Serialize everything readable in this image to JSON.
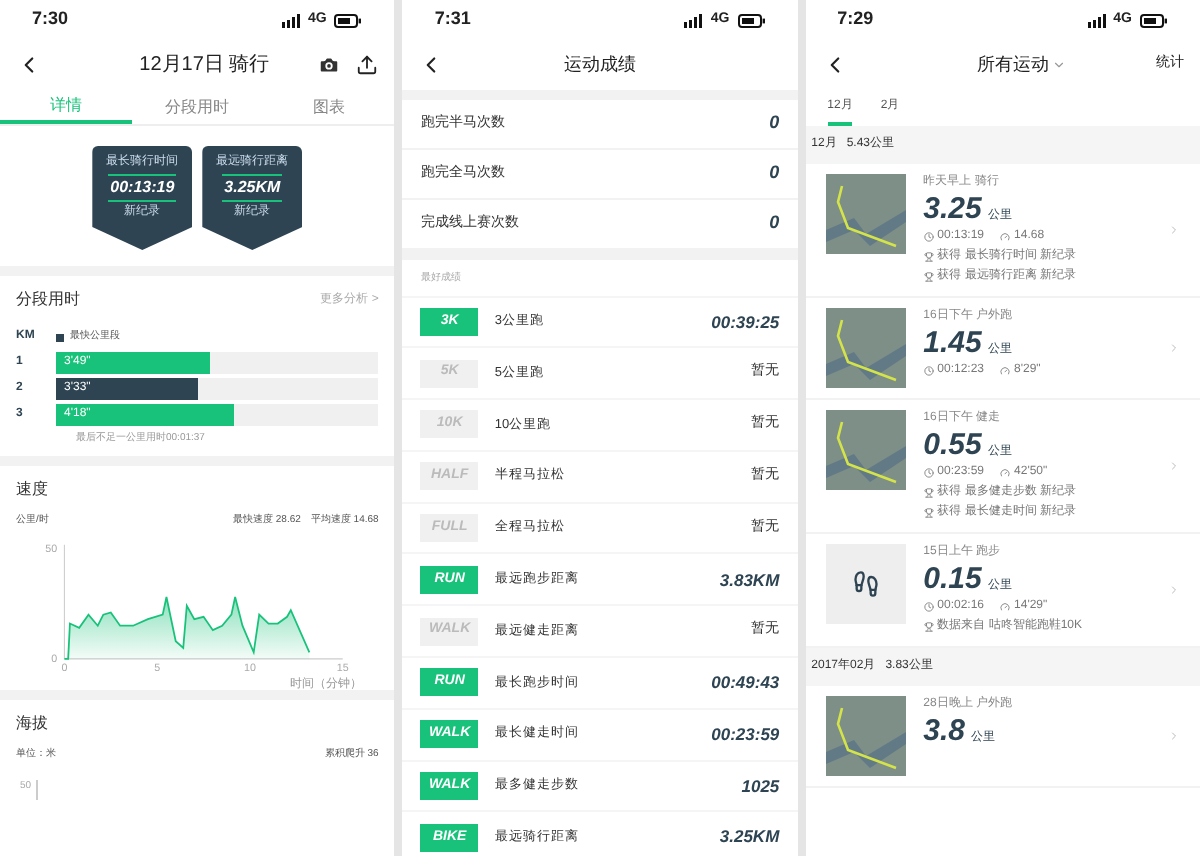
{
  "panels": [
    {
      "status_bar": {
        "time": "7:30",
        "network": "4G"
      },
      "header": {
        "title": "12月17日 骑行"
      },
      "tabs": [
        {
          "label": "详情",
          "selected": true
        },
        {
          "label": "分段用时",
          "selected": false
        },
        {
          "label": "图表",
          "selected": false
        }
      ],
      "badges": [
        {
          "title": "最长骑行时间",
          "value": "00:13:19",
          "sub": "新纪录"
        },
        {
          "title": "最远骑行距离",
          "value": "3.25KM",
          "sub": "新纪录"
        }
      ],
      "splits": {
        "title": "分段用时",
        "more": "更多分析 >",
        "km_label": "KM",
        "legend": "最快公里段",
        "rows": [
          {
            "km": "1",
            "time": "3'49\"",
            "level": 0.48,
            "fastest": false
          },
          {
            "km": "2",
            "time": "3'33\"",
            "level": 0.44,
            "fastest": true
          },
          {
            "km": "3",
            "time": "4'18\"",
            "level": 0.55,
            "fastest": false
          }
        ],
        "note": "最后不足一公里用时00:01:37"
      },
      "speed": {
        "title": "速度",
        "unit": "公里/时",
        "max": "最快速度 28.62",
        "avg": "平均速度 14.68",
        "chart_data": {
          "type": "area",
          "xlabel": "时间（分钟）",
          "x": [
            0,
            0.2,
            0.3,
            0.8,
            1.3,
            1.8,
            2.1,
            2.5,
            3,
            3.7,
            4.5,
            5.3,
            5.5,
            6,
            6.4,
            6.6,
            7,
            7.5,
            8,
            8.5,
            9,
            9.2,
            9.6,
            10.2,
            10.5,
            11,
            11.5,
            12,
            12.2,
            13.2
          ],
          "series": [
            {
              "color": "#19c27a",
              "values": [
                0,
                0,
                16,
                14,
                20,
                15,
                20,
                21,
                15,
                15,
                18,
                20,
                28,
                8,
                5,
                24,
                18,
                19,
                13,
                15,
                20,
                28,
                15,
                3,
                20,
                16,
                16,
                19,
                22,
                3
              ]
            }
          ],
          "xlim": [
            0,
            15
          ],
          "ylim": [
            0,
            50
          ],
          "xticks": [
            0,
            5,
            10,
            15
          ],
          "yticks": [
            0,
            50
          ]
        }
      },
      "altitude": {
        "title": "海拔",
        "unit": "单位：米",
        "climb": "累积爬升 36",
        "ytick": "50"
      }
    },
    {
      "status_bar": {
        "time": "7:31",
        "network": "4G"
      },
      "header": {
        "title": "运动成绩"
      },
      "counts": [
        {
          "label": "跑完半马次数",
          "value": "0"
        },
        {
          "label": "跑完全马次数",
          "value": "0"
        },
        {
          "label": "完成线上赛次数",
          "value": "0"
        }
      ],
      "records_title": "最好成绩",
      "records": [
        {
          "tag": "3K",
          "label": "3公里跑",
          "value": "00:39:25",
          "achieved": true
        },
        {
          "tag": "5K",
          "label": "5公里跑",
          "value": "暂无",
          "achieved": false
        },
        {
          "tag": "10K",
          "label": "10公里跑",
          "value": "暂无",
          "achieved": false
        },
        {
          "tag": "HALF",
          "label": "半程马拉松",
          "value": "暂无",
          "achieved": false
        },
        {
          "tag": "FULL",
          "label": "全程马拉松",
          "value": "暂无",
          "achieved": false
        },
        {
          "tag": "RUN",
          "label": "最远跑步距离",
          "value": "3.83KM",
          "achieved": true
        },
        {
          "tag": "WALK",
          "label": "最远健走距离",
          "value": "暂无",
          "achieved": false
        },
        {
          "tag": "RUN",
          "label": "最长跑步时间",
          "value": "00:49:43",
          "achieved": true
        },
        {
          "tag": "WALK",
          "label": "最长健走时间",
          "value": "00:23:59",
          "achieved": true
        },
        {
          "tag": "WALK",
          "label": "最多健走步数",
          "value": "1025",
          "achieved": true
        },
        {
          "tag": "BIKE",
          "label": "最远骑行距离",
          "value": "3.25KM",
          "achieved": true
        }
      ]
    },
    {
      "status_bar": {
        "time": "7:29",
        "network": "4G"
      },
      "header": {
        "title": "所有运动",
        "action": "统计"
      },
      "tabs": [
        {
          "label": "12月",
          "selected": true
        },
        {
          "label": "2月",
          "selected": false
        }
      ],
      "groups": [
        {
          "month": "12月",
          "total": "5.43公里",
          "activities": [
            {
              "kind": "map",
              "meta": "昨天早上 骑行",
              "distance": "3.25",
              "unit": "公里",
              "duration": "00:13:19",
              "pace": "14.68",
              "notes": [
                "获得 最长骑行时间 新纪录",
                "获得 最远骑行距离 新纪录"
              ]
            },
            {
              "kind": "map",
              "meta": "16日下午 户外跑",
              "distance": "1.45",
              "unit": "公里",
              "duration": "00:12:23",
              "pace": "8'29\""
            },
            {
              "kind": "map",
              "meta": "16日下午 健走",
              "distance": "0.55",
              "unit": "公里",
              "duration": "00:23:59",
              "pace": "42'50\"",
              "notes": [
                "获得 最多健走步数 新纪录",
                "获得 最长健走时间 新纪录"
              ]
            },
            {
              "kind": "device",
              "meta": "15日上午 跑步",
              "distance": "0.15",
              "unit": "公里",
              "duration": "00:02:16",
              "pace": "14'29\"",
              "notes": [
                "数据来自 咕咚智能跑鞋10K"
              ]
            }
          ]
        },
        {
          "month": "2017年02月",
          "total": "3.83公里",
          "activities": [
            {
              "kind": "map",
              "meta": "28日晚上 户外跑",
              "distance": "3.8",
              "unit": "公里"
            }
          ]
        }
      ]
    }
  ]
}
